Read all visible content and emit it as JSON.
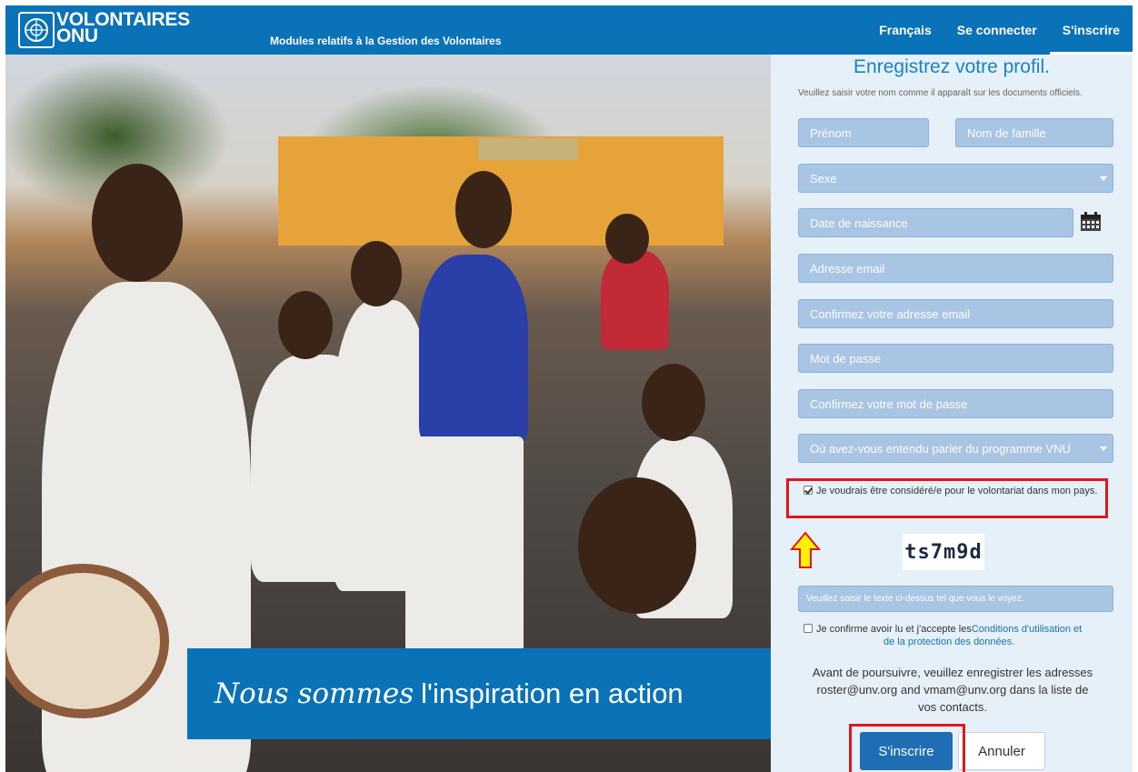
{
  "header": {
    "logo_line1": "VOLONTAIRES",
    "logo_line2": "ONU",
    "subtitle": "Modules relatifs à la Gestion des Volontaires",
    "nav": [
      {
        "label": "Français"
      },
      {
        "label": "Se connecter"
      },
      {
        "label": "S'inscrire",
        "active": true
      }
    ]
  },
  "hero": {
    "banner_script": "Nous sommes",
    "banner_main": "l'inspiration en action"
  },
  "form": {
    "title": "Enregistrez votre profil.",
    "instruction": "Veuillez saisir votre nom comme il apparaît sur les documents officiels.",
    "first_name_placeholder": "Prénom",
    "last_name_placeholder": "Nom de famille",
    "gender_placeholder": "Sexe",
    "birth_date_placeholder": "Date de naissance",
    "email_placeholder": "Adresse email",
    "confirm_email_placeholder": "Confirmez votre adresse email",
    "password_placeholder": "Mot de passe",
    "confirm_password_placeholder": "Confirmez votre mot de passe",
    "source_placeholder": "Où avez-vous entendu parler du programme VNU",
    "national_checkbox": {
      "label": "Je voudrais être considéré/e pour le volontariat dans mon pays.",
      "checked": true
    },
    "captcha_text": "ts7m9d",
    "captcha_input_placeholder": "Veuillez saisir le texte ci-dessus tel que vous le voyez.",
    "terms_checkbox": {
      "prefix": "Je confirme avoir lu et j'accepte les",
      "link": "Conditions d'utilisation et",
      "link2": "de la protection des données.",
      "checked": false
    },
    "notice": "Avant de poursuivre, veuillez enregistrer les adresses roster@unv.org and vmam@unv.org dans la liste de vos contacts.",
    "submit_label": "S'inscrire",
    "cancel_label": "Annuler"
  },
  "colors": {
    "brand_blue": "#0a73b7",
    "field_blue": "#a9c5e4",
    "highlight_red": "#e2161b",
    "arrow_yellow": "#fff200"
  }
}
